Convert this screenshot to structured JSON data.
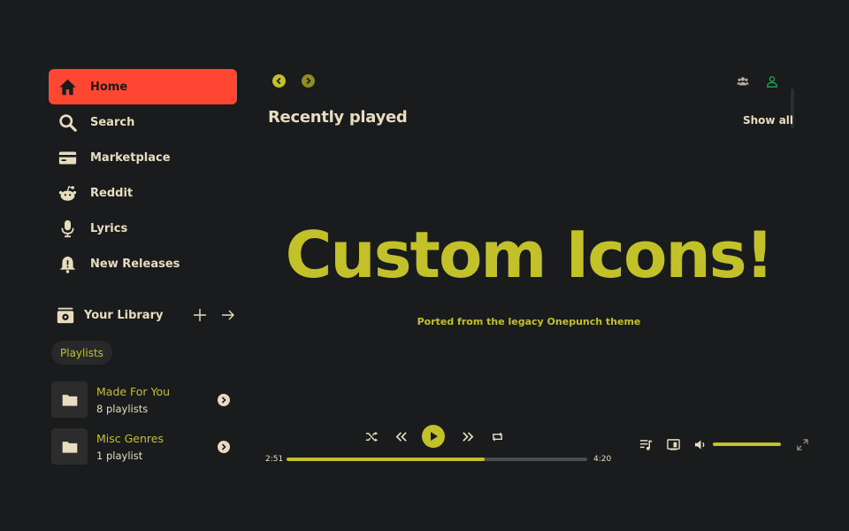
{
  "colors": {
    "background": "#191b1c",
    "accent": "#c3c12a",
    "active_nav": "#fe4632",
    "text": "#e8dcc0"
  },
  "sidebar": {
    "items": [
      {
        "label": "Home",
        "icon": "home-icon",
        "active": true
      },
      {
        "label": "Search",
        "icon": "search-icon"
      },
      {
        "label": "Marketplace",
        "icon": "card-icon"
      },
      {
        "label": "Reddit",
        "icon": "reddit-icon"
      },
      {
        "label": "Lyrics",
        "icon": "microphone-icon"
      },
      {
        "label": "New Releases",
        "icon": "bell-icon"
      }
    ]
  },
  "library": {
    "title": "Your Library",
    "filter_chip": "Playlists",
    "items": [
      {
        "name": "Made For You",
        "subtitle": "8 playlists",
        "icon": "folder-icon"
      },
      {
        "name": "Misc Genres",
        "subtitle": "1 playlist",
        "icon": "folder-icon"
      }
    ]
  },
  "main": {
    "section_title": "Recently played",
    "show_all": "Show all",
    "hero_title": "Custom Icons!",
    "hero_subtitle": "Ported from the legacy Onepunch theme"
  },
  "player": {
    "elapsed": "2:51",
    "duration": "4:20",
    "progress": 0.66,
    "volume": 1.0
  }
}
